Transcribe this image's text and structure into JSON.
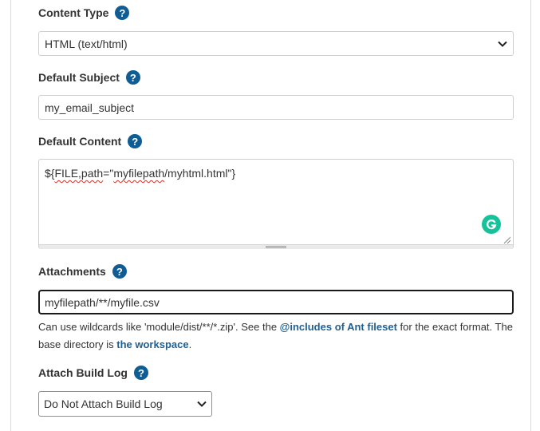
{
  "content_type": {
    "label": "Content Type",
    "help": "?",
    "selected": "HTML (text/html)"
  },
  "default_subject": {
    "label": "Default Subject",
    "help": "?",
    "value": "my_email_subject"
  },
  "default_content": {
    "label": "Default Content",
    "help": "?",
    "value_part1": "${",
    "value_word1": "FILE,path",
    "value_part2": "=\"",
    "value_word2": "myfilepath",
    "value_part3": "/myhtml.html\"}",
    "assistant_icon": "grammarly-icon"
  },
  "attachments": {
    "label": "Attachments",
    "help": "?",
    "value": "myfilepath/**/myfile.csv",
    "help_text_1": "Can use wildcards like 'module/dist/**/*.zip'. See the ",
    "link_1": "@includes of Ant fileset",
    "help_text_2": " for the exact format. The base directory is ",
    "link_2": "the workspace",
    "help_text_3": "."
  },
  "attach_build_log": {
    "label": "Attach Build Log",
    "help": "?",
    "selected": "Do Not Attach Build Log"
  },
  "colors": {
    "help_icon": "#0f5d94",
    "link": "#1f5f91",
    "focus_border": "#1a1a1a",
    "grammarly": "#15c39a"
  }
}
